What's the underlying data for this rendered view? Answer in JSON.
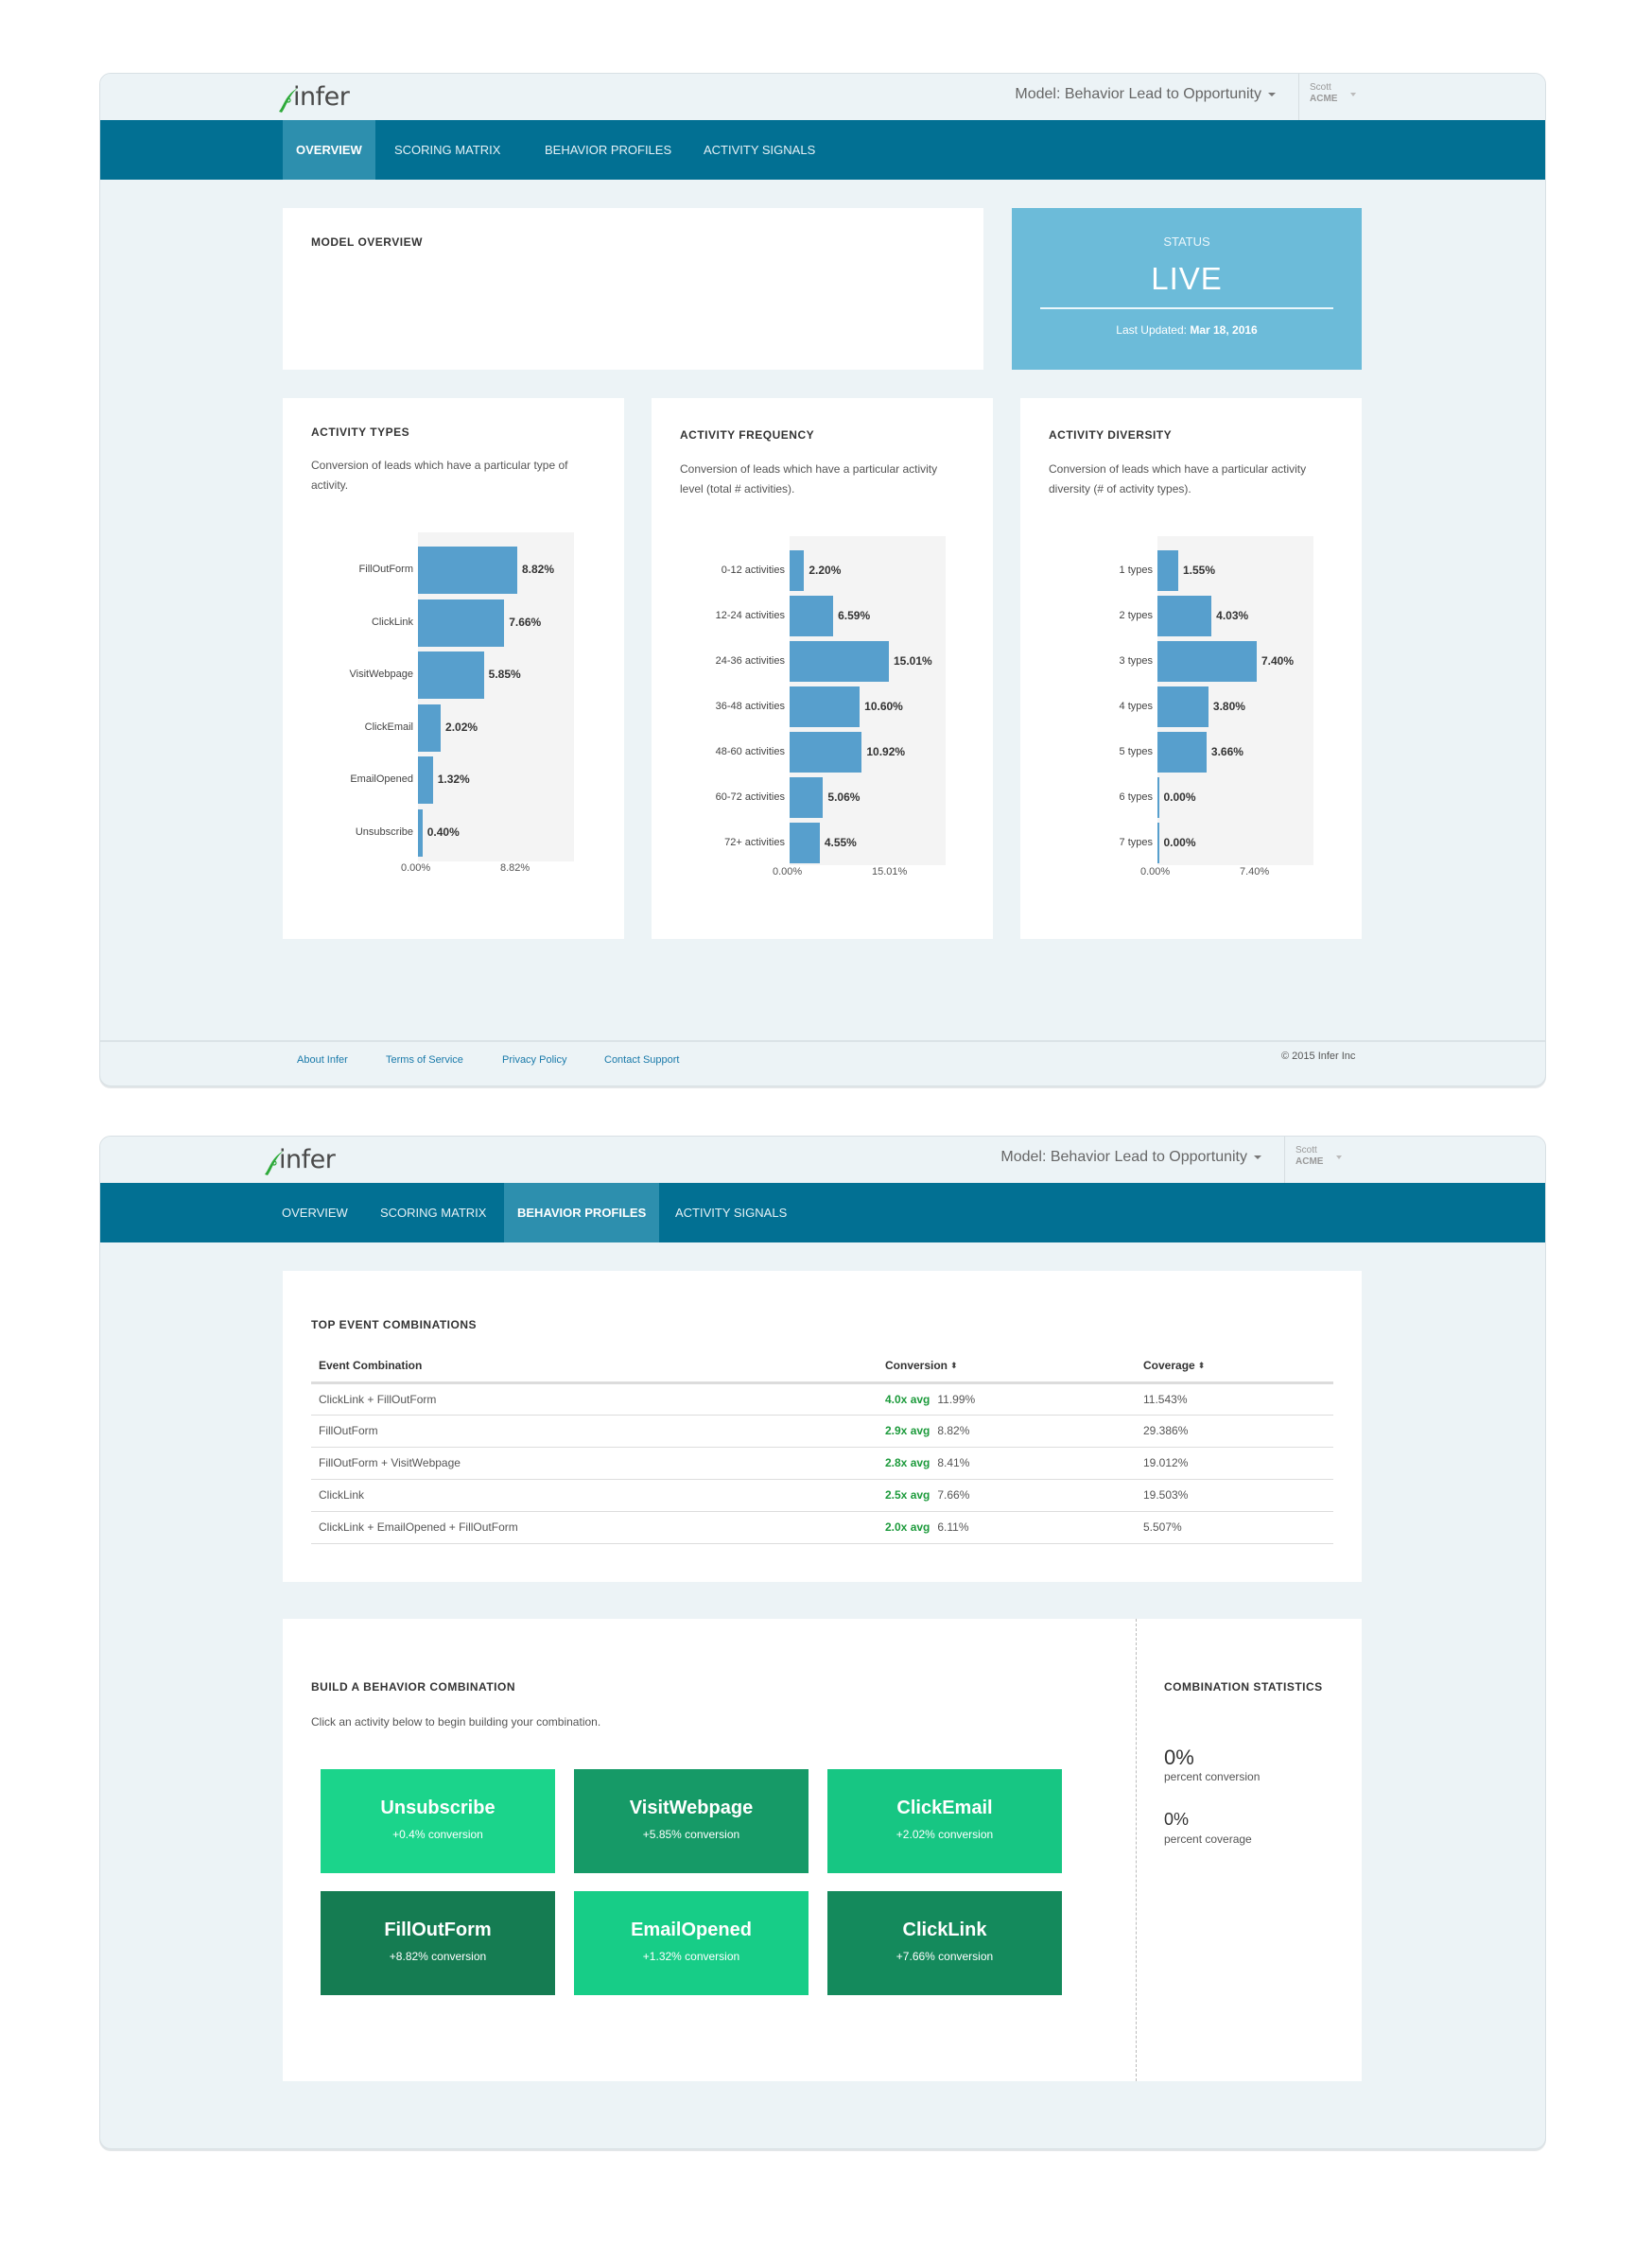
{
  "brand": {
    "logo_text": "infer",
    "logo_color": "#2eaa3a"
  },
  "header": {
    "model_label": "Model: Behavior Lead to Opportunity",
    "user_name": "Scott",
    "user_org": "ACME"
  },
  "nav": {
    "tabs": [
      {
        "label": "OVERVIEW"
      },
      {
        "label": "SCORING MATRIX"
      },
      {
        "label": "BEHAVIOR PROFILES"
      },
      {
        "label": "ACTIVITY SIGNALS"
      }
    ]
  },
  "overview_page": {
    "active_tab": "OVERVIEW",
    "model_overview_title": "MODEL OVERVIEW",
    "status": {
      "label": "STATUS",
      "value": "LIVE",
      "last_updated_label": "Last Updated:",
      "last_updated_value": "Mar 18, 2016",
      "color": "#6cbbd9"
    }
  },
  "chart_data": [
    {
      "type": "bar",
      "orientation": "horizontal",
      "title": "ACTIVITY TYPES",
      "subtitle": "Conversion of leads which have a particular type of activity.",
      "categories": [
        "FillOutForm",
        "ClickLink",
        "VisitWebpage",
        "ClickEmail",
        "EmailOpened",
        "Unsubscribe"
      ],
      "values": [
        8.82,
        7.66,
        5.85,
        2.02,
        1.32,
        0.4
      ],
      "value_labels": [
        "8.82%",
        "7.66%",
        "5.85%",
        "2.02%",
        "1.32%",
        "0.40%"
      ],
      "xlim": [
        0,
        8.82
      ],
      "x_tick_labels": [
        "0.00%",
        "8.82%"
      ],
      "xlabel": "",
      "ylabel": "",
      "bar_color": "#579fcd"
    },
    {
      "type": "bar",
      "orientation": "horizontal",
      "title": "ACTIVITY FREQUENCY",
      "subtitle": "Conversion of leads which have a particular activity level (total # activities).",
      "categories": [
        "0-12 activities",
        "12-24 activities",
        "24-36 activities",
        "36-48 activities",
        "48-60 activities",
        "60-72 activities",
        "72+ activities"
      ],
      "values": [
        2.2,
        6.59,
        15.01,
        10.6,
        10.92,
        5.06,
        4.55
      ],
      "value_labels": [
        "2.20%",
        "6.59%",
        "15.01%",
        "10.60%",
        "10.92%",
        "5.06%",
        "4.55%"
      ],
      "xlim": [
        0,
        15.01
      ],
      "x_tick_labels": [
        "0.00%",
        "15.01%"
      ],
      "xlabel": "",
      "ylabel": "",
      "bar_color": "#579fcd"
    },
    {
      "type": "bar",
      "orientation": "horizontal",
      "title": "ACTIVITY DIVERSITY",
      "subtitle": "Conversion of leads which have a particular activity diversity (# of activity types).",
      "categories": [
        "1 types",
        "2 types",
        "3 types",
        "4 types",
        "5 types",
        "6 types",
        "7 types"
      ],
      "values": [
        1.55,
        4.03,
        7.4,
        3.8,
        3.66,
        0.0,
        0.0
      ],
      "value_labels": [
        "1.55%",
        "4.03%",
        "7.40%",
        "3.80%",
        "3.66%",
        "0.00%",
        "0.00%"
      ],
      "xlim": [
        0,
        7.4
      ],
      "x_tick_labels": [
        "0.00%",
        "7.40%"
      ],
      "xlabel": "",
      "ylabel": "",
      "bar_color": "#579fcd"
    }
  ],
  "footer": {
    "links": [
      "About Infer",
      "Terms of Service",
      "Privacy Policy",
      "Contact Support"
    ],
    "copyright": "© 2015 Infer Inc"
  },
  "behavior_page": {
    "active_tab": "BEHAVIOR PROFILES",
    "top_combos": {
      "title": "TOP EVENT COMBINATIONS",
      "columns": [
        "Event Combination",
        "Conversion",
        "Coverage"
      ],
      "rows": [
        {
          "combination": "ClickLink + FillOutForm",
          "avg": "4.0x avg",
          "conversion": "11.99%",
          "coverage": "11.543%"
        },
        {
          "combination": "FillOutForm",
          "avg": "2.9x avg",
          "conversion": "8.82%",
          "coverage": "29.386%"
        },
        {
          "combination": "FillOutForm + VisitWebpage",
          "avg": "2.8x avg",
          "conversion": "8.41%",
          "coverage": "19.012%"
        },
        {
          "combination": "ClickLink",
          "avg": "2.5x avg",
          "conversion": "7.66%",
          "coverage": "19.503%"
        },
        {
          "combination": "ClickLink + EmailOpened + FillOutForm",
          "avg": "2.0x avg",
          "conversion": "6.11%",
          "coverage": "5.507%"
        }
      ],
      "avg_color": "#1c9a3b"
    },
    "builder": {
      "title": "BUILD A BEHAVIOR COMBINATION",
      "instructions": "Click an activity below to begin building your combination.",
      "tiles": [
        {
          "name": "Unsubscribe",
          "conversion": "+0.4% conversion",
          "color": "#1bd48b"
        },
        {
          "name": "VisitWebpage",
          "conversion": "+5.85% conversion",
          "color": "#169a67"
        },
        {
          "name": "ClickEmail",
          "conversion": "+2.02% conversion",
          "color": "#17c683"
        },
        {
          "name": "FillOutForm",
          "conversion": "+8.82% conversion",
          "color": "#157c52"
        },
        {
          "name": "EmailOpened",
          "conversion": "+1.32% conversion",
          "color": "#17cd87"
        },
        {
          "name": "ClickLink",
          "conversion": "+7.66% conversion",
          "color": "#148a5c"
        }
      ]
    },
    "stats": {
      "title": "COMBINATION STATISTICS",
      "conversion_value": "0%",
      "conversion_label": "percent conversion",
      "coverage_value": "0%",
      "coverage_label": "percent coverage"
    }
  }
}
